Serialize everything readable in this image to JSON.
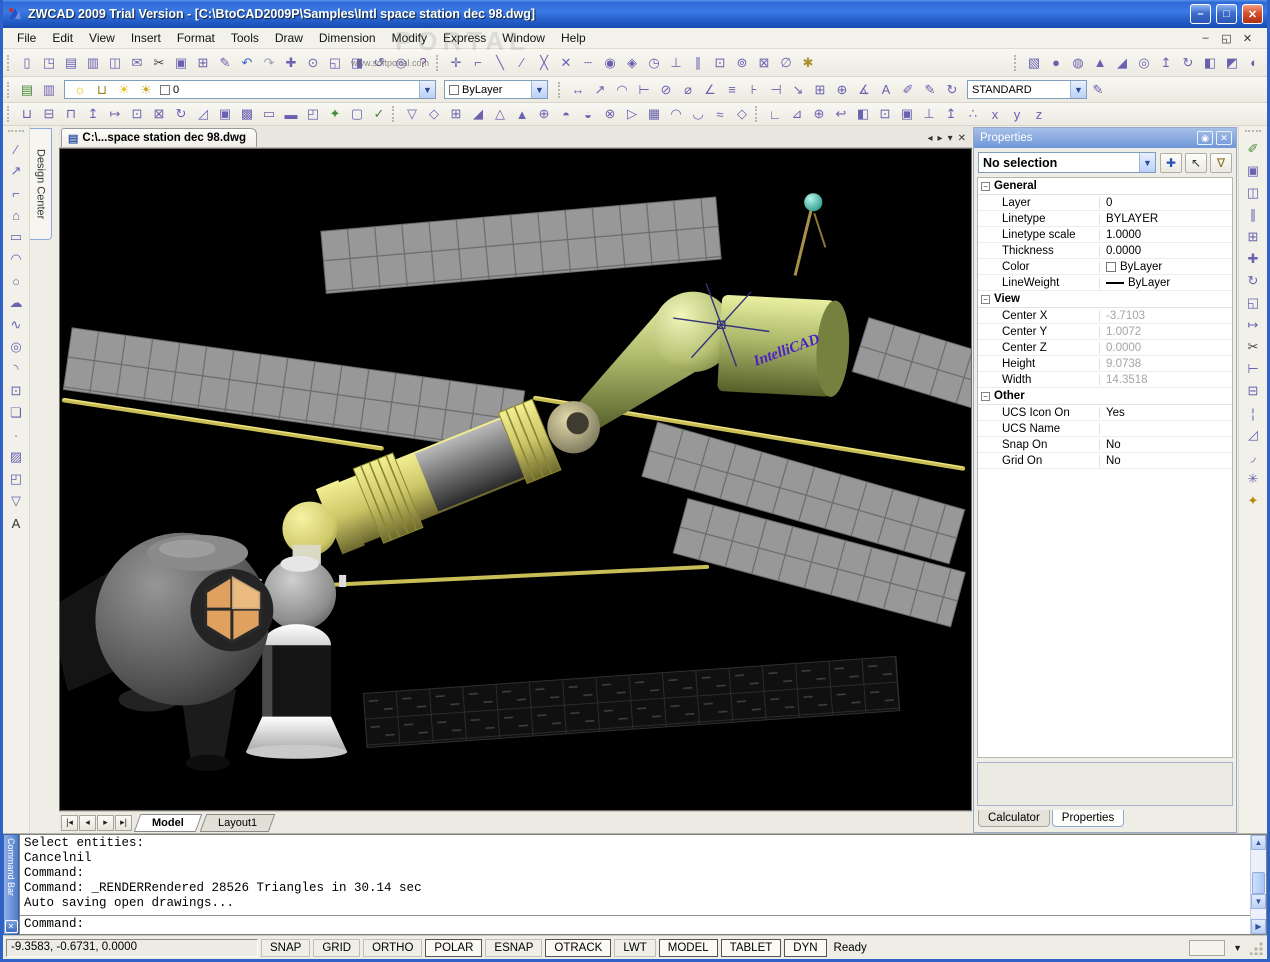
{
  "window": {
    "title": "ZWCAD 2009 Trial Version - [C:\\BtoCAD2009P\\Samples\\Intl space station dec 98.dwg]",
    "controls": {
      "minimize": "–",
      "maximize": "□",
      "close": "✕"
    },
    "mdi_controls": {
      "minimize": "–",
      "restore": "◱",
      "close": "✕"
    }
  },
  "watermark": {
    "small": "www.softportal.com",
    "big": "PORTAL"
  },
  "menu": {
    "items": [
      "File",
      "Edit",
      "View",
      "Insert",
      "Format",
      "Tools",
      "Draw",
      "Dimension",
      "Modify",
      "Express",
      "Window",
      "Help"
    ]
  },
  "toolbars": {
    "standard": [
      {
        "n": "new",
        "g": "▯"
      },
      {
        "n": "open",
        "g": "◳"
      },
      {
        "n": "save",
        "g": "▤"
      },
      {
        "n": "plot",
        "g": "▥"
      },
      {
        "n": "print-preview",
        "g": "◫"
      },
      {
        "n": "publish",
        "g": "✉"
      },
      {
        "n": "cut",
        "g": "✂",
        "c": "#444"
      },
      {
        "n": "copy",
        "g": "▣"
      },
      {
        "n": "paste",
        "g": "⊞"
      },
      {
        "n": "match-properties",
        "g": "✎"
      },
      {
        "n": "undo",
        "g": "↶",
        "c": "#3A62C8"
      },
      {
        "n": "redo",
        "g": "↷",
        "c": "#9AA0B8"
      },
      {
        "n": "pan",
        "g": "✚"
      },
      {
        "n": "zoom-realtime",
        "g": "⊙"
      },
      {
        "n": "zoom-window",
        "g": "◱"
      },
      {
        "n": "zoom-previous",
        "g": "◨"
      },
      {
        "n": "regen",
        "g": "↺"
      },
      {
        "n": "find",
        "g": "◎"
      },
      {
        "n": "help",
        "g": "?",
        "c": "#7A4AB0"
      }
    ],
    "osnap": [
      {
        "n": "temporary-track-point",
        "g": "✛"
      },
      {
        "n": "snap-from",
        "g": "⌐"
      },
      {
        "n": "snap-endpoint",
        "g": "╲"
      },
      {
        "n": "snap-midpoint",
        "g": "∕"
      },
      {
        "n": "snap-intersection",
        "g": "╳"
      },
      {
        "n": "snap-apparent-intersection",
        "g": "✕"
      },
      {
        "n": "snap-extension",
        "g": "┄"
      },
      {
        "n": "snap-center",
        "g": "◉"
      },
      {
        "n": "snap-quadrant",
        "g": "◈"
      },
      {
        "n": "snap-tangent",
        "g": "◷"
      },
      {
        "n": "snap-perpendicular",
        "g": "⊥"
      },
      {
        "n": "snap-parallel",
        "g": "∥"
      },
      {
        "n": "snap-insertion",
        "g": "⊡"
      },
      {
        "n": "snap-node",
        "g": "⊚"
      },
      {
        "n": "snap-nearest",
        "g": "⊠"
      },
      {
        "n": "snap-none",
        "g": "∅"
      },
      {
        "n": "osnap-settings",
        "g": "✱",
        "c": "#A8922C"
      }
    ],
    "solids": [
      {
        "n": "solid-box",
        "g": "▧"
      },
      {
        "n": "solid-sphere",
        "g": "●"
      },
      {
        "n": "solid-cylinder",
        "g": "◍"
      },
      {
        "n": "solid-cone",
        "g": "▲"
      },
      {
        "n": "solid-wedge",
        "g": "◢"
      },
      {
        "n": "solid-torus",
        "g": "◎"
      },
      {
        "n": "extrude",
        "g": "↥"
      },
      {
        "n": "revolve",
        "g": "↻"
      },
      {
        "n": "slice",
        "g": "◧"
      },
      {
        "n": "section",
        "g": "◩"
      },
      {
        "n": "interfere",
        "g": "◐"
      }
    ],
    "layers_left": [
      {
        "n": "layer-properties",
        "g": "▤",
        "c": "#4A8A3A"
      },
      {
        "n": "layer-previous",
        "g": "▥",
        "c": "#6A62B0"
      }
    ],
    "layer_field_icons": [
      {
        "n": "layer-on-bulb",
        "g": "☼",
        "c": "#E8B800"
      },
      {
        "n": "layer-unlock",
        "g": "⊔",
        "c": "#9A8420"
      },
      {
        "n": "layer-freeze-sun",
        "g": "☀",
        "c": "#E8C020"
      },
      {
        "n": "layer-thaw-sun",
        "g": "☀",
        "c": "#C8A818"
      }
    ],
    "layer_value": "0",
    "color_value": "ByLayer",
    "dimension": [
      {
        "n": "dim-linear",
        "g": "↔"
      },
      {
        "n": "dim-aligned",
        "g": "↗"
      },
      {
        "n": "dim-arc",
        "g": "◠"
      },
      {
        "n": "dim-ordinate",
        "g": "⊢"
      },
      {
        "n": "dim-radius",
        "g": "⊘"
      },
      {
        "n": "dim-diameter",
        "g": "⌀"
      },
      {
        "n": "dim-angular",
        "g": "∠"
      },
      {
        "n": "dim-quick",
        "g": "≡"
      },
      {
        "n": "dim-baseline",
        "g": "⊦"
      },
      {
        "n": "dim-continue",
        "g": "⊣"
      },
      {
        "n": "dim-leader",
        "g": "↘"
      },
      {
        "n": "dim-tolerance",
        "g": "⊞"
      },
      {
        "n": "dim-center-mark",
        "g": "⊕"
      },
      {
        "n": "dim-oblique",
        "g": "∡"
      },
      {
        "n": "dim-text-angle",
        "g": "A"
      },
      {
        "n": "dim-edit",
        "g": "✐"
      },
      {
        "n": "dim-text-edit",
        "g": "✎"
      },
      {
        "n": "dim-update",
        "g": "↻"
      }
    ],
    "dimension_style": "STANDARD",
    "dim_style_icon": {
      "n": "dim-style",
      "g": "✎"
    },
    "solids_editing": [
      {
        "n": "union",
        "g": "⊔"
      },
      {
        "n": "subtract",
        "g": "⊟"
      },
      {
        "n": "intersect",
        "g": "⊓"
      },
      {
        "n": "extrude-faces",
        "g": "↥"
      },
      {
        "n": "move-faces",
        "g": "↦"
      },
      {
        "n": "offset-faces",
        "g": "⊡"
      },
      {
        "n": "delete-faces",
        "g": "⊠"
      },
      {
        "n": "rotate-faces",
        "g": "↻"
      },
      {
        "n": "taper-faces",
        "g": "◿"
      },
      {
        "n": "copy-faces",
        "g": "▣"
      },
      {
        "n": "color-faces",
        "g": "▩"
      },
      {
        "n": "copy-edges",
        "g": "▭"
      },
      {
        "n": "color-edges",
        "g": "▬"
      },
      {
        "n": "imprint",
        "g": "◰"
      },
      {
        "n": "clean",
        "g": "✦",
        "c": "#4A8A3A"
      },
      {
        "n": "shell",
        "g": "▢"
      },
      {
        "n": "check",
        "g": "✓",
        "c": "#4A8A3A"
      }
    ],
    "surfaces": [
      {
        "n": "2d-solid",
        "g": "▽"
      },
      {
        "n": "3d-face",
        "g": "◇"
      },
      {
        "n": "surf-box",
        "g": "⊞"
      },
      {
        "n": "surf-wedge",
        "g": "◢"
      },
      {
        "n": "surf-pyramid",
        "g": "△"
      },
      {
        "n": "surf-cone",
        "g": "▲"
      },
      {
        "n": "surf-sphere",
        "g": "⊕"
      },
      {
        "n": "surf-dome",
        "g": "◓"
      },
      {
        "n": "surf-dish",
        "g": "◒"
      },
      {
        "n": "surf-torus",
        "g": "⊗"
      },
      {
        "n": "surf-edge",
        "g": "▷"
      },
      {
        "n": "3d-mesh",
        "g": "▦"
      },
      {
        "n": "revolved-surface",
        "g": "◠"
      },
      {
        "n": "tabulated-surface",
        "g": "◡"
      },
      {
        "n": "ruled-surface",
        "g": "≈"
      },
      {
        "n": "edge-surface",
        "g": "◇"
      }
    ],
    "ucs": [
      {
        "n": "ucs",
        "g": "∟"
      },
      {
        "n": "ucs-named",
        "g": "⊿"
      },
      {
        "n": "ucs-world",
        "g": "⊕"
      },
      {
        "n": "ucs-previous",
        "g": "↩"
      },
      {
        "n": "ucs-face",
        "g": "◧"
      },
      {
        "n": "ucs-object",
        "g": "⊡"
      },
      {
        "n": "ucs-view",
        "g": "▣"
      },
      {
        "n": "ucs-origin",
        "g": "⊥"
      },
      {
        "n": "ucs-z-axis",
        "g": "↥"
      },
      {
        "n": "ucs-3-point",
        "g": "∴"
      },
      {
        "n": "ucs-x-rotate",
        "g": "x"
      },
      {
        "n": "ucs-y-rotate",
        "g": "y"
      },
      {
        "n": "ucs-z-rotate",
        "g": "z"
      }
    ],
    "draw": [
      {
        "n": "line",
        "g": "∕"
      },
      {
        "n": "construction-line",
        "g": "↗"
      },
      {
        "n": "polyline",
        "g": "⌐"
      },
      {
        "n": "polygon",
        "g": "⌂"
      },
      {
        "n": "rectangle",
        "g": "▭"
      },
      {
        "n": "arc",
        "g": "◠"
      },
      {
        "n": "circle",
        "g": "○"
      },
      {
        "n": "revision-cloud",
        "g": "☁"
      },
      {
        "n": "spline",
        "g": "∿"
      },
      {
        "n": "ellipse",
        "g": "◎"
      },
      {
        "n": "ellipse-arc",
        "g": "◝"
      },
      {
        "n": "insert-block",
        "g": "⊡"
      },
      {
        "n": "make-block",
        "g": "❏"
      },
      {
        "n": "point",
        "g": "·"
      },
      {
        "n": "hatch",
        "g": "▨"
      },
      {
        "n": "region",
        "g": "◰"
      },
      {
        "n": "wipeout",
        "g": "▽"
      },
      {
        "n": "text",
        "g": "A",
        "c": "#333"
      }
    ],
    "modify": [
      {
        "n": "erase",
        "g": "✐",
        "c": "#4A8A3A"
      },
      {
        "n": "copy-object",
        "g": "▣"
      },
      {
        "n": "mirror",
        "g": "◫"
      },
      {
        "n": "offset",
        "g": "∥"
      },
      {
        "n": "array",
        "g": "⊞"
      },
      {
        "n": "move",
        "g": "✚"
      },
      {
        "n": "rotate",
        "g": "↻"
      },
      {
        "n": "scale",
        "g": "◱"
      },
      {
        "n": "stretch",
        "g": "↦"
      },
      {
        "n": "trim",
        "g": "✂",
        "c": "#444"
      },
      {
        "n": "extend",
        "g": "⊢"
      },
      {
        "n": "break",
        "g": "⊟"
      },
      {
        "n": "break-at-point",
        "g": "¦"
      },
      {
        "n": "chamfer",
        "g": "◿"
      },
      {
        "n": "fillet",
        "g": "◞"
      },
      {
        "n": "explode",
        "g": "✳"
      },
      {
        "n": "clean-broom",
        "g": "✦",
        "c": "#B8860B"
      }
    ]
  },
  "design_center": {
    "tab_label": "Design Center"
  },
  "document": {
    "tab": "C:\\...space station dec 98.dwg",
    "tab_controls": {
      "prev": "◂",
      "next": "▸",
      "menu": "▾",
      "close": "✕"
    },
    "nav_buttons": [
      "|◂",
      "◂",
      "▸",
      "▸|"
    ],
    "model_tabs": [
      "Model",
      "Layout1"
    ],
    "active_model_tab": 0
  },
  "drawing": {
    "label": "IntelliCAD"
  },
  "properties_panel": {
    "title": "Properties",
    "pin_icon": "◉",
    "close_icon": "✕",
    "selection": "No selection",
    "buttons": [
      {
        "n": "quick-select",
        "g": "✚",
        "c": "#2A52B8"
      },
      {
        "n": "select-entities",
        "g": "↖",
        "c": "#333"
      },
      {
        "n": "toggle-pickadd",
        "g": "∇",
        "c": "#8A6A10"
      }
    ],
    "sections": [
      {
        "name": "General",
        "rows": [
          {
            "label": "Layer",
            "value": "0"
          },
          {
            "label": "Linetype",
            "value": "BYLAYER"
          },
          {
            "label": "Linetype scale",
            "value": "1.0000"
          },
          {
            "label": "Thickness",
            "value": "0.0000"
          },
          {
            "label": "Color",
            "value": "ByLayer",
            "swatch": "#FFFFFF"
          },
          {
            "label": "LineWeight",
            "value": "ByLayer",
            "line": true
          }
        ]
      },
      {
        "name": "View",
        "rows": [
          {
            "label": "Center X",
            "value": "-3.7103",
            "dim": true
          },
          {
            "label": "Center Y",
            "value": "1.0072",
            "dim": true
          },
          {
            "label": "Center Z",
            "value": "0.0000",
            "dim": true
          },
          {
            "label": "Height",
            "value": "9.0738",
            "dim": true
          },
          {
            "label": "Width",
            "value": "14.3518",
            "dim": true
          }
        ]
      },
      {
        "name": "Other",
        "rows": [
          {
            "label": "UCS Icon On",
            "value": "Yes"
          },
          {
            "label": "UCS Name",
            "value": ""
          },
          {
            "label": "Snap On",
            "value": "No"
          },
          {
            "label": "Grid On",
            "value": "No"
          }
        ]
      }
    ],
    "tabs": [
      "Calculator",
      "Properties"
    ],
    "active_tab": 1
  },
  "command_bar": {
    "strip_label": "Command Bar",
    "close_icon": "✕",
    "history": [
      "Select entities:",
      "Cancelnil",
      "Command:",
      "Command: _RENDERRendered 28526 Triangles in 30.14 sec",
      "Auto saving open drawings..."
    ],
    "prompt": "Command:"
  },
  "status_bar": {
    "coords": "-9.3583,  -0.6731,  0.0000",
    "toggles": [
      {
        "label": "SNAP",
        "on": false
      },
      {
        "label": "GRID",
        "on": false
      },
      {
        "label": "ORTHO",
        "on": false
      },
      {
        "label": "POLAR",
        "on": true
      },
      {
        "label": "ESNAP",
        "on": false
      },
      {
        "label": "OTRACK",
        "on": true
      },
      {
        "label": "LWT",
        "on": false
      },
      {
        "label": "MODEL",
        "on": true
      },
      {
        "label": "TABLET",
        "on": true
      },
      {
        "label": "DYN",
        "on": true
      }
    ],
    "ready": "Ready"
  }
}
